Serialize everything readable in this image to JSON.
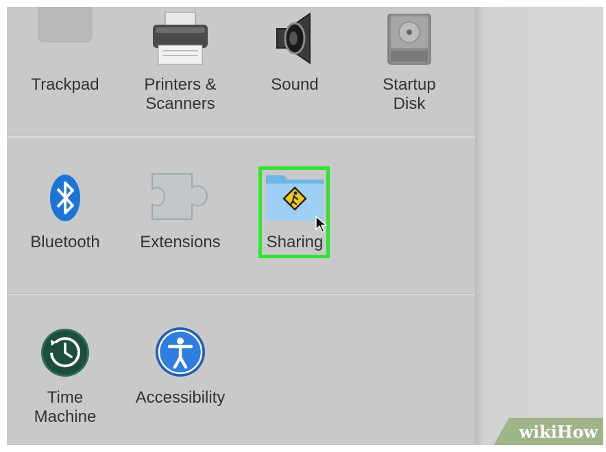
{
  "sections": [
    {
      "panes": [
        {
          "id": "trackpad",
          "lines": [
            "Trackpad"
          ],
          "icon": "trackpad-icon"
        },
        {
          "id": "printers",
          "lines": [
            "Printers &",
            "Scanners"
          ],
          "icon": "printer-icon"
        },
        {
          "id": "sound",
          "lines": [
            "Sound"
          ],
          "icon": "speaker-icon"
        },
        {
          "id": "startup",
          "lines": [
            "Startup",
            "Disk"
          ],
          "icon": "hard-disk-icon"
        }
      ]
    },
    {
      "panes": [
        {
          "id": "bluetooth",
          "lines": [
            "Bluetooth"
          ],
          "icon": "bluetooth-icon"
        },
        {
          "id": "extensions",
          "lines": [
            "Extensions"
          ],
          "icon": "puzzle-piece-icon"
        },
        {
          "id": "sharing",
          "lines": [
            "Sharing"
          ],
          "icon": "sharing-folder-icon",
          "highlighted": true
        }
      ]
    },
    {
      "panes": [
        {
          "id": "timemachine",
          "lines": [
            "Time",
            "Machine"
          ],
          "icon": "time-machine-icon"
        },
        {
          "id": "accessibility",
          "lines": [
            "Accessibility"
          ],
          "icon": "accessibility-icon"
        }
      ]
    }
  ],
  "highlight_color": "#2fe52f",
  "watermark": {
    "wiki": "wiki",
    "how": "How"
  }
}
